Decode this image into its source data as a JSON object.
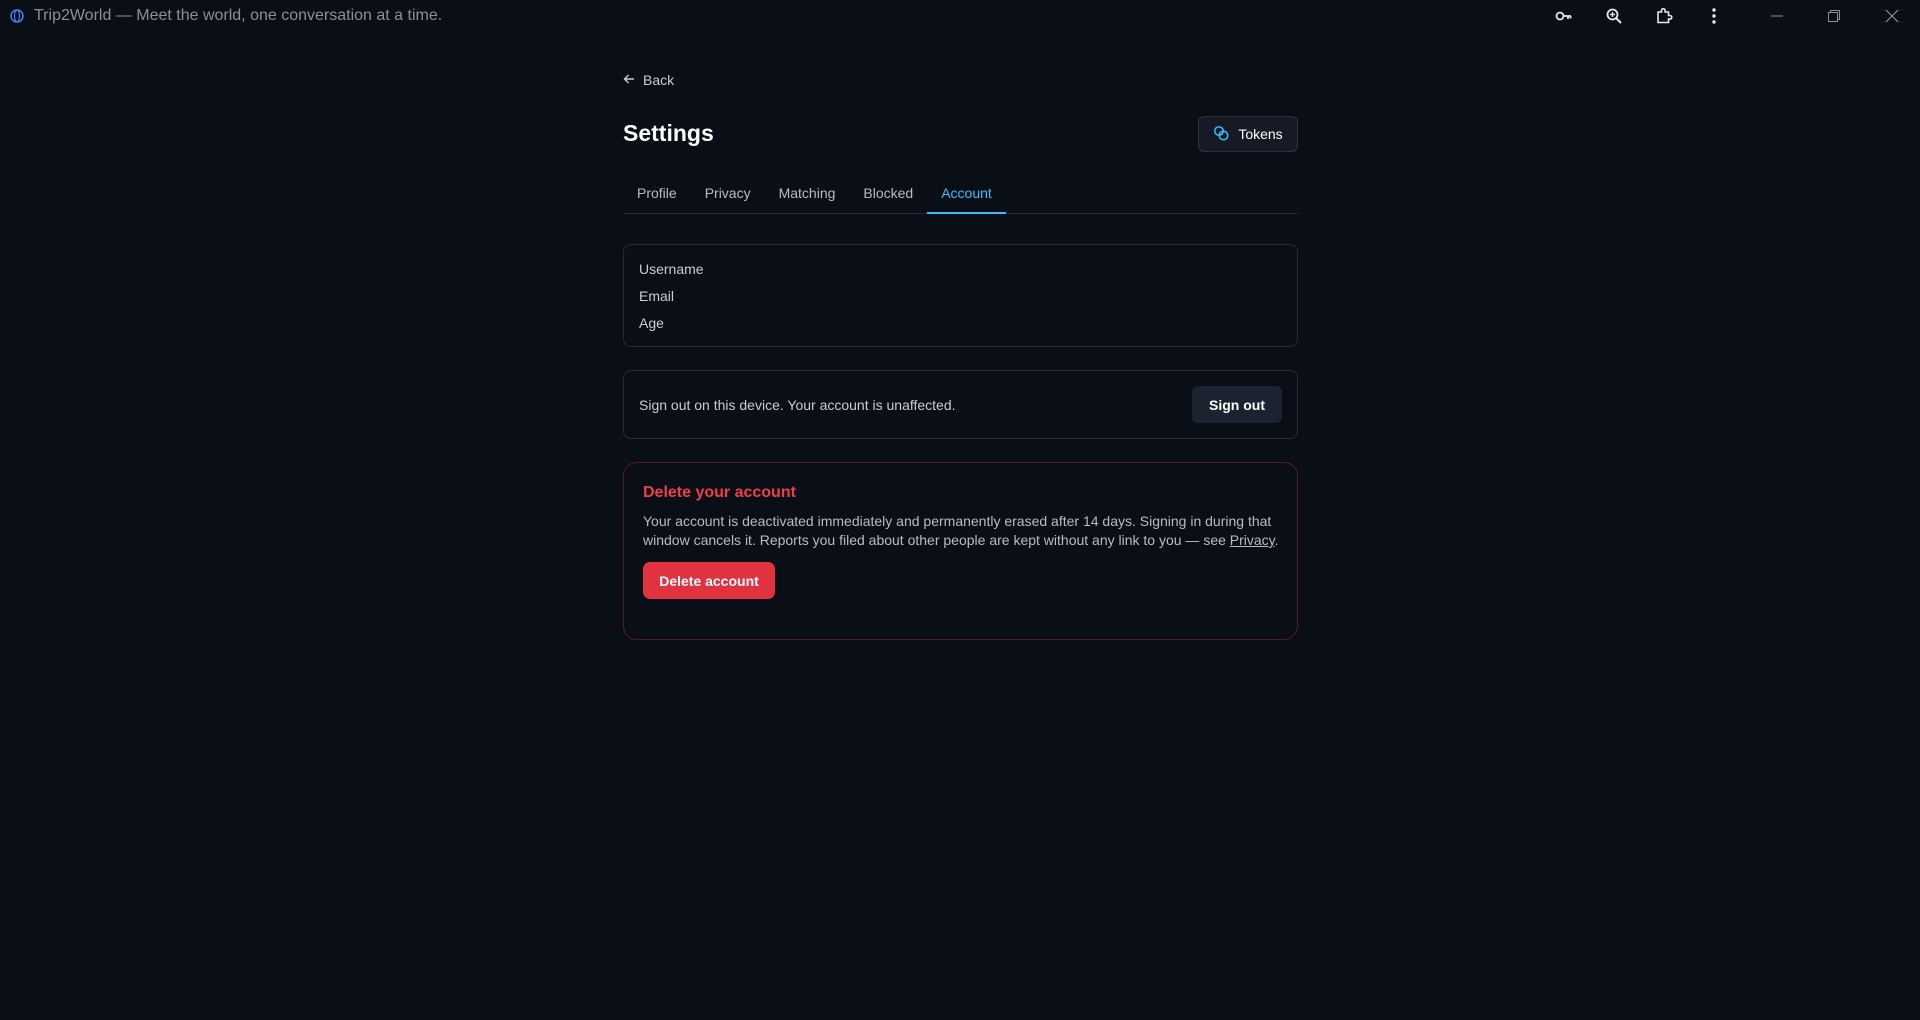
{
  "window": {
    "title": "Trip2World — Meet the world, one conversation at a time."
  },
  "nav": {
    "back_label": "Back"
  },
  "header": {
    "title": "Settings",
    "tokens_label": "Tokens"
  },
  "tabs": [
    {
      "label": "Profile",
      "active": false
    },
    {
      "label": "Privacy",
      "active": false
    },
    {
      "label": "Matching",
      "active": false
    },
    {
      "label": "Blocked",
      "active": false
    },
    {
      "label": "Account",
      "active": true
    }
  ],
  "account_info": {
    "fields": [
      "Username",
      "Email",
      "Age"
    ]
  },
  "signout": {
    "text": "Sign out on this device. Your account is unaffected.",
    "button_label": "Sign out"
  },
  "delete": {
    "title": "Delete your account",
    "text_before_link": "Your account is deactivated immediately and permanently erased after 14 days. Signing in during that window cancels it. Reports you filed about other people are kept without any link to you — see ",
    "link_label": "Privacy",
    "text_after_link": ".",
    "button_label": "Delete account"
  },
  "colors": {
    "background": "#0a0e16",
    "accent": "#38bdf8",
    "danger": "#e0323f"
  },
  "icons": {
    "app": "globe-icon",
    "titlebar": [
      "key-icon",
      "zoom-icon",
      "extensions-icon",
      "more-vert-icon",
      "minimize-icon",
      "restore-icon",
      "close-icon"
    ],
    "back": "arrow-left-icon",
    "tokens": "coins-icon"
  }
}
